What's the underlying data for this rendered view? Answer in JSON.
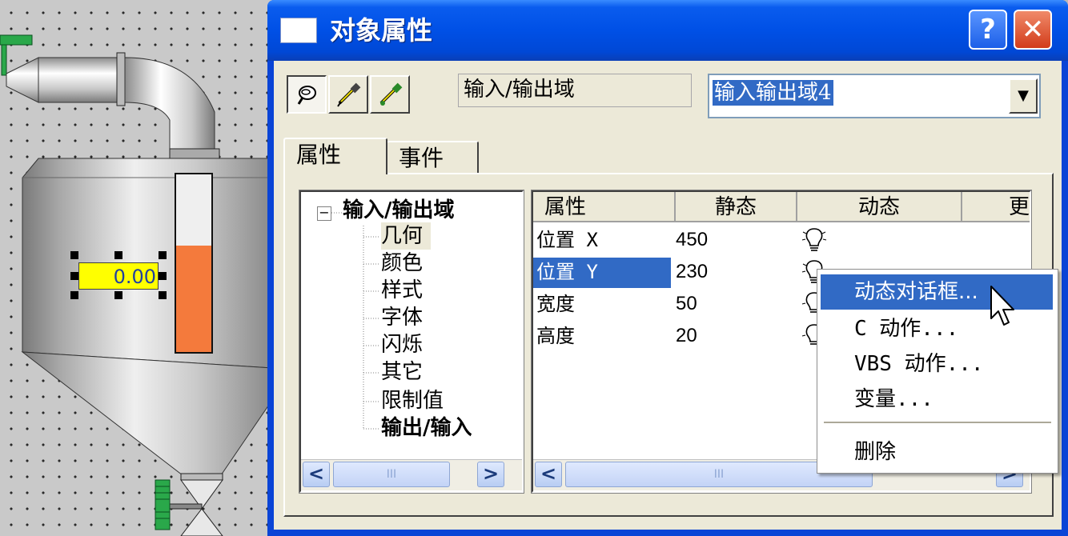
{
  "canvas": {
    "io_field_value": "0.00",
    "level_fraction": 0.6
  },
  "dialog": {
    "title": "对象属性",
    "help_glyph": "?",
    "close_glyph": "✕",
    "toolbar": {
      "icons": [
        "pin-icon",
        "eyedropper-icon",
        "paste-properties-icon"
      ]
    },
    "object_type": "输入/输出域",
    "object_name": "输入输出域4",
    "tabs": [
      "属性",
      "事件"
    ]
  },
  "tree": {
    "root": "输入/输出域",
    "items": [
      "几何",
      "颜色",
      "样式",
      "字体",
      "闪烁",
      "其它",
      "限制值",
      "输出/输入"
    ]
  },
  "grid": {
    "headers": [
      "属性",
      "静态",
      "动态",
      "更"
    ],
    "rows": [
      {
        "prop": "位置 X",
        "static": "450"
      },
      {
        "prop": "位置 Y",
        "static": "230"
      },
      {
        "prop": "宽度",
        "static": "50"
      },
      {
        "prop": "高度",
        "static": "20"
      }
    ]
  },
  "context_menu": {
    "items": [
      "动态对话框...",
      "C 动作...",
      "VBS 动作...",
      "变量...",
      "删除"
    ]
  },
  "scrollbar": {
    "grip": "III",
    "left": "<",
    "right": ">"
  }
}
